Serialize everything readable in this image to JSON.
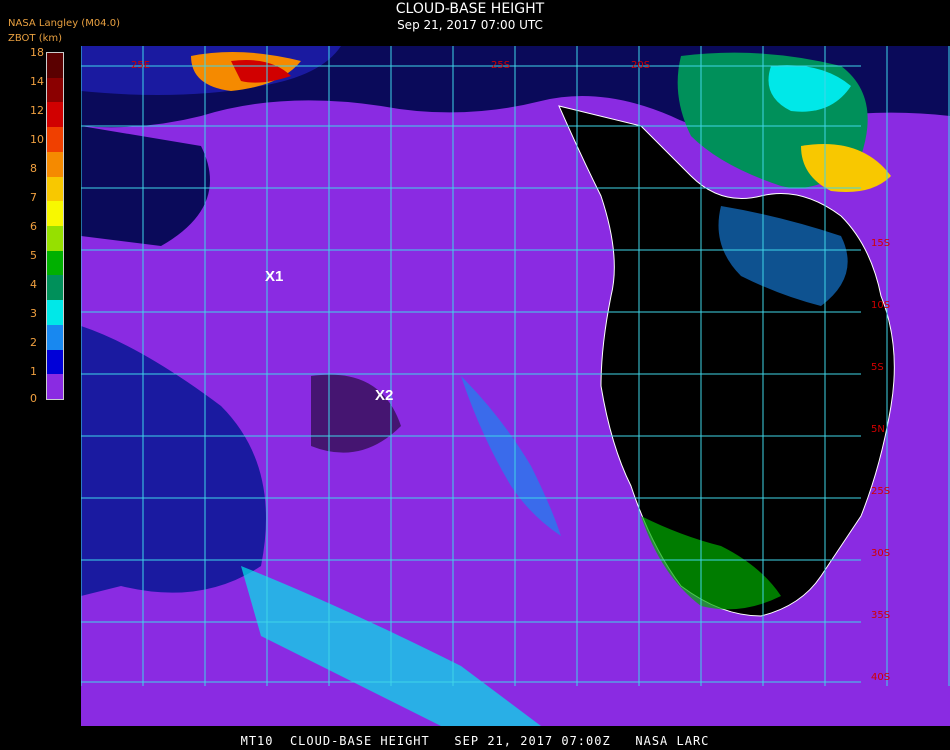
{
  "header": {
    "source": "NASA Langley (M04.0)",
    "product_code": "ZBOT (km)",
    "title": "CLOUD-BASE HEIGHT",
    "subtitle": "Sep 21, 2017 07:00 UTC"
  },
  "legend": {
    "ticks": [
      "18",
      "14",
      "12",
      "10",
      "8",
      "7",
      "6",
      "5",
      "4",
      "3",
      "2",
      "1",
      "0"
    ],
    "colors": [
      "#5a0000",
      "#8b0000",
      "#d10000",
      "#f04000",
      "#f58a00",
      "#f8c800",
      "#f8f800",
      "#96e000",
      "#00b000",
      "#00905a",
      "#00e8e8",
      "#1888f0",
      "#0000d8",
      "#8a2be2"
    ]
  },
  "map": {
    "grid_color": "#3fd6e8",
    "coast_color": "#ffffff",
    "lat_labels": [
      "25E",
      "25S",
      "20S",
      "15S",
      "10S",
      "5S",
      "5N",
      "25S",
      "30S",
      "35S",
      "40S"
    ],
    "markers": [
      {
        "label": "X1"
      },
      {
        "label": "X2"
      }
    ]
  },
  "footer": {
    "text": "MT10  CLOUD-BASE HEIGHT   SEP 21, 2017 07:00Z   NASA LARC"
  }
}
